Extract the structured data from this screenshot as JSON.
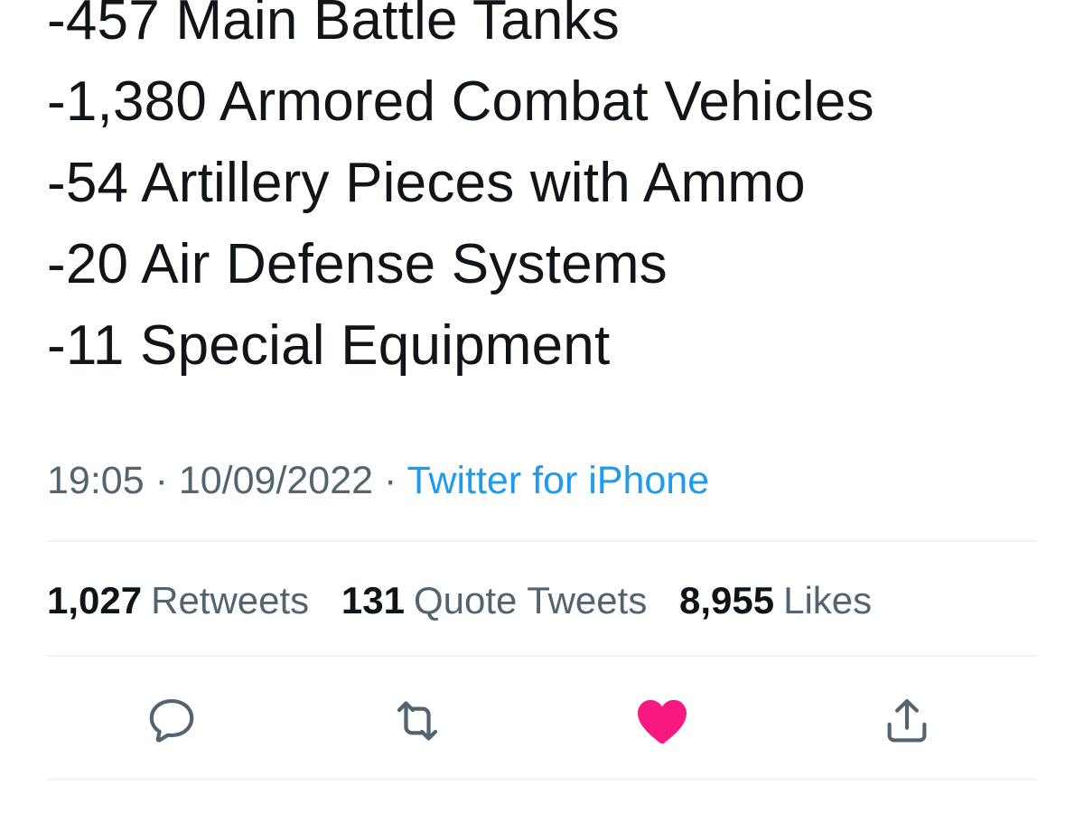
{
  "tweet": {
    "lines": [
      "-457 Main Battle Tanks",
      "-1,380 Armored Combat Vehicles",
      "-54 Artillery Pieces with Ammo",
      "-20 Air Defense Systems",
      "-11 Special Equipment"
    ],
    "time": "19:05",
    "separator": "·",
    "date": "10/09/2022",
    "source": "Twitter for iPhone"
  },
  "stats": {
    "retweets": {
      "count": "1,027",
      "label": "Retweets"
    },
    "quote_tweets": {
      "count": "131",
      "label": "Quote Tweets"
    },
    "likes": {
      "count": "8,955",
      "label": "Likes"
    }
  },
  "actions": {
    "reply_icon": "reply-icon",
    "retweet_icon": "retweet-icon",
    "like_icon": "heart-icon",
    "share_icon": "share-icon"
  },
  "colors": {
    "text": "#0f1419",
    "secondary_text": "#536471",
    "link": "#1d9bf0",
    "like_active": "#f91880",
    "divider": "#eff3f4"
  }
}
